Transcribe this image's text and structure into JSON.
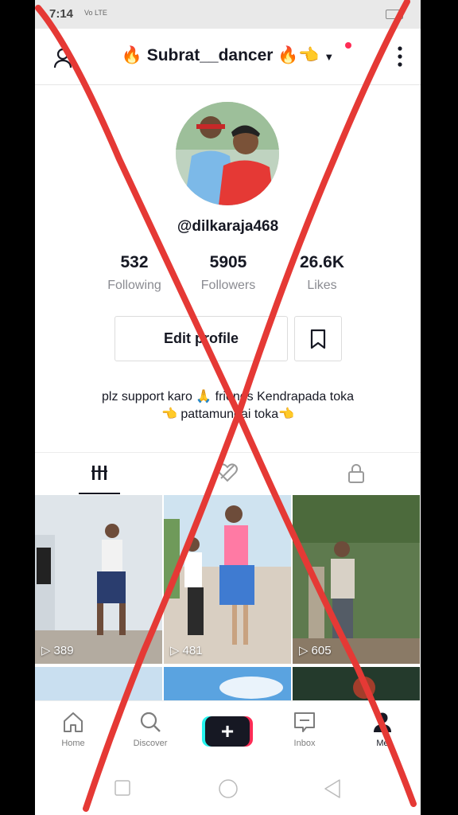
{
  "status_bar": {
    "time": "7:14",
    "signal": "Vo LTE"
  },
  "header": {
    "username_display": "🔥 Subrat__dancer 🔥👈"
  },
  "profile": {
    "handle": "@dilkaraja468",
    "stats": [
      {
        "value": "532",
        "label": "Following"
      },
      {
        "value": "5905",
        "label": "Followers"
      },
      {
        "value": "26.6K",
        "label": "Likes"
      }
    ],
    "edit_label": "Edit profile",
    "bio_line1": "plz support karo 🙏 friends  Kendrapada toka",
    "bio_line2": "👈 pattamundai toka👈"
  },
  "videos": [
    {
      "views": "389"
    },
    {
      "views": "481"
    },
    {
      "views": "605"
    }
  ],
  "nav": {
    "home": "Home",
    "discover": "Discover",
    "create": "+",
    "inbox": "Inbox",
    "me": "Me"
  },
  "colors": {
    "accent": "#fe2c55",
    "cyan": "#25f4ee",
    "cross": "#e53935"
  }
}
